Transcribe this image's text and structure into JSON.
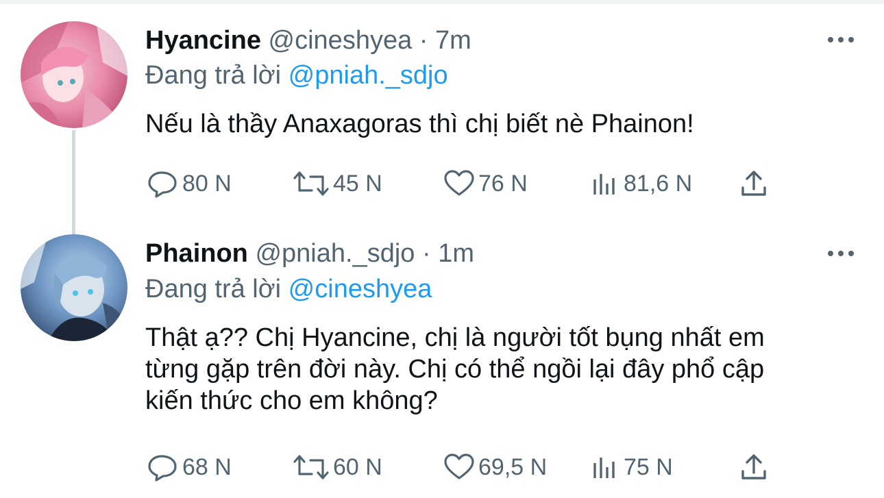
{
  "tweets": [
    {
      "name": "Hyancine",
      "handle": "@cineshyea",
      "separator": "·",
      "time": "7m",
      "reply_prefix": "Đang trả lời",
      "reply_to": "@pniah._sdjo",
      "text": "Nếu là thầy Anaxagoras thì chị biết nè Phainon!",
      "replies": "80 N",
      "retweets": "45 N",
      "likes": "76 N",
      "views": "81,6 N"
    },
    {
      "name": "Phainon",
      "handle": "@pniah._sdjo",
      "separator": "·",
      "time": "1m",
      "reply_prefix": "Đang trả lời",
      "reply_to": "@cineshyea",
      "text": "Thật ạ?? Chị Hyancine, chị là người tốt bụng nhất em từng gặp trên đời này. Chị có thể ngồi lại đây phổ cập kiến thức cho em không?",
      "replies": "68 N",
      "retweets": "60 N",
      "likes": "69,5 N",
      "views": "75 N"
    }
  ],
  "icons": {
    "reply": "reply-bubble-icon",
    "retweet": "retweet-arrows-icon",
    "like": "heart-icon",
    "views": "bar-chart-icon",
    "share": "share-upload-icon",
    "more": "more-dots-icon"
  },
  "colors": {
    "text": "#0f1419",
    "secondary": "#536471",
    "link": "#1d9bf0",
    "thread_line": "#cfd9de"
  }
}
